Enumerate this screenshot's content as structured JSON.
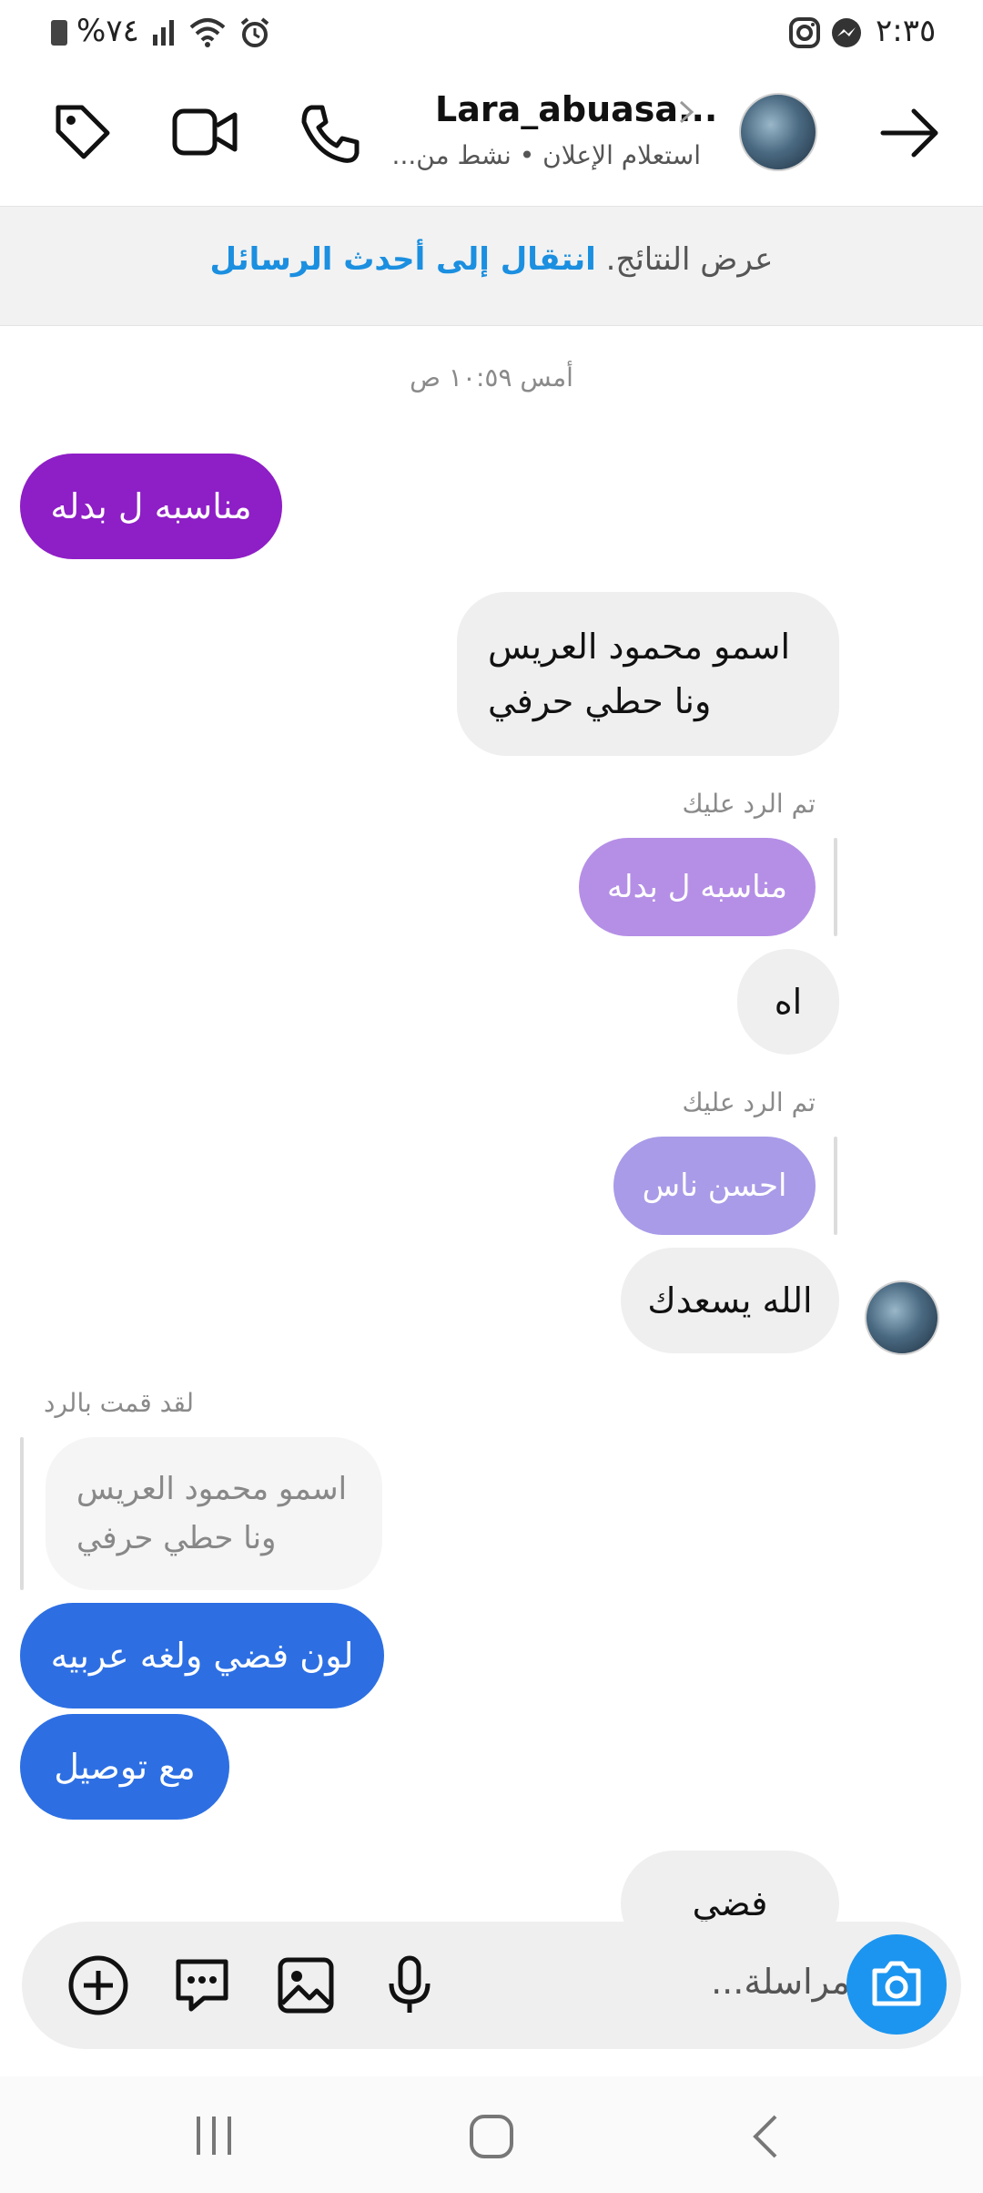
{
  "status_bar": {
    "battery": "%٧٤",
    "time": "٢:٣٥"
  },
  "header": {
    "username": "Lara_abuasa...",
    "subtitle": "استعلام الإعلان • نشط من...",
    "icons": [
      "tag-icon",
      "video-call-icon",
      "phone-icon",
      "chevron-icon",
      "back-arrow-icon"
    ]
  },
  "banner": {
    "prefix": "عرض النتائج.",
    "link": "انتقال إلى أحدث الرسائل"
  },
  "conversation": {
    "timestamp": "أمس ١٠:٥٩ ص",
    "messages": [
      {
        "text": "مناسبه ل بدله",
        "color": "#8e1ec6"
      },
      {
        "line1": "اسمو  محمود العريس",
        "line2": "ونا حطي حرفي"
      },
      {
        "reply_note": "تم الرد عليك",
        "quoted": "مناسبه ل بدله",
        "quoted_color": "#b58fe6"
      },
      {
        "text": "اه"
      },
      {
        "reply_note": "تم الرد عليك",
        "quoted": "احسن ناس",
        "quoted_color": "#a99be8"
      },
      {
        "text": "الله يسعدك"
      },
      {
        "reply_note": "لقد قمت بالرد",
        "quoted_line1": "اسمو  محمود العريس",
        "quoted_line2": "ونا حطي حرفي"
      },
      {
        "text": "لون فضي ولغه عربيه",
        "color": "#2d6fe3"
      },
      {
        "text": "مع توصيل",
        "color": "#2d6fe3"
      },
      {
        "text": "فضي"
      }
    ]
  },
  "composer": {
    "placeholder": "مراسلة...",
    "camera_color": "#1b95f0",
    "icons": [
      "add-icon",
      "sticker-icon",
      "gallery-icon",
      "microphone-icon",
      "camera-icon"
    ]
  },
  "navbar": {
    "icons": [
      "recent-apps-icon",
      "home-icon",
      "back-icon"
    ]
  }
}
